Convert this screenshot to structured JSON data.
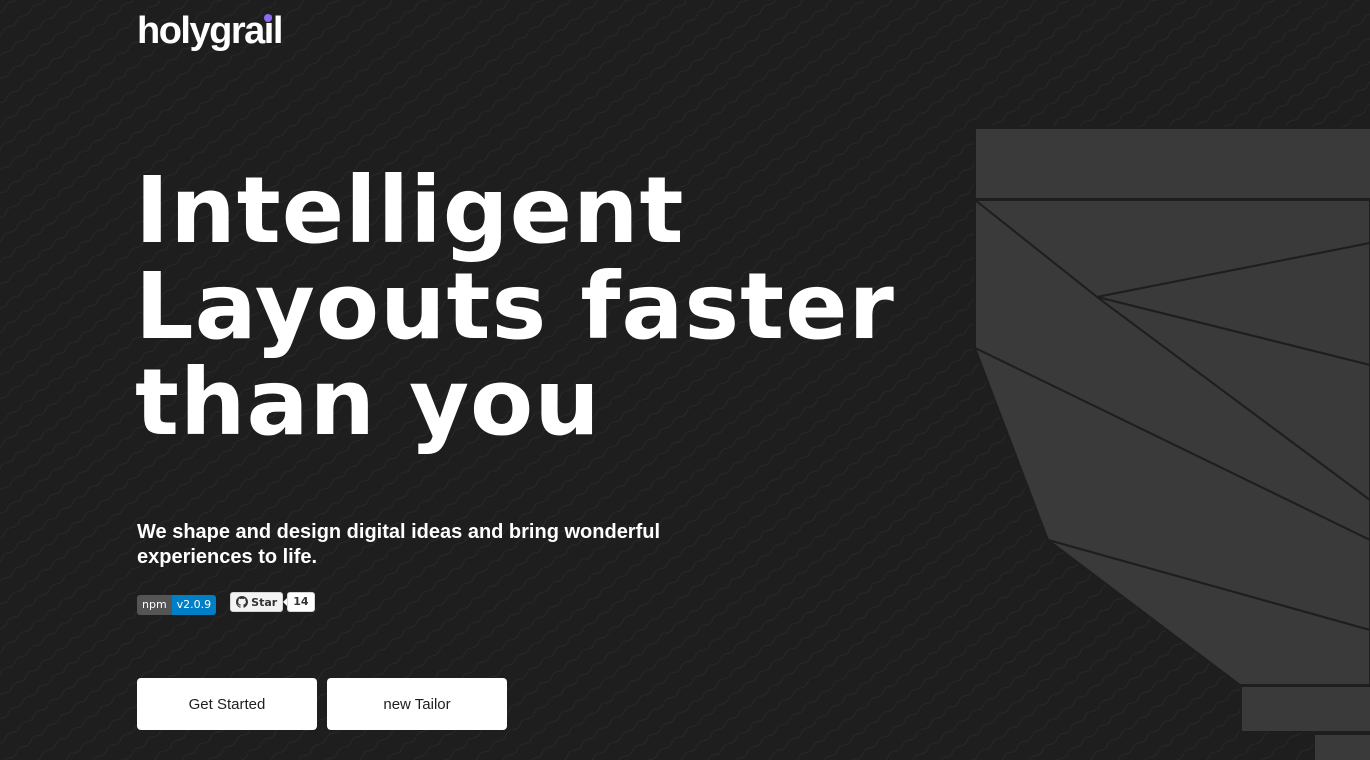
{
  "brand": {
    "logo_text": "holygrail",
    "logo_prefix": "holygra",
    "logo_i": "i",
    "logo_suffix": "l",
    "accent": "#8a6cf0"
  },
  "hero": {
    "headline_lines": [
      "Intelligent",
      "Layouts faster",
      "than you"
    ],
    "subtitle": "We shape and design digital ideas and bring wonderful experiences to life."
  },
  "badges": {
    "npm_label": "npm",
    "npm_version": "v2.0.9",
    "github_label": "Star",
    "github_count": "14"
  },
  "actions": {
    "primary_label": "Get Started",
    "secondary_label": "new Tailor"
  },
  "colors": {
    "background": "#1e1e1e",
    "panel": "#3a3a3a",
    "text": "#ffffff",
    "npm_blue": "#007ec6"
  }
}
